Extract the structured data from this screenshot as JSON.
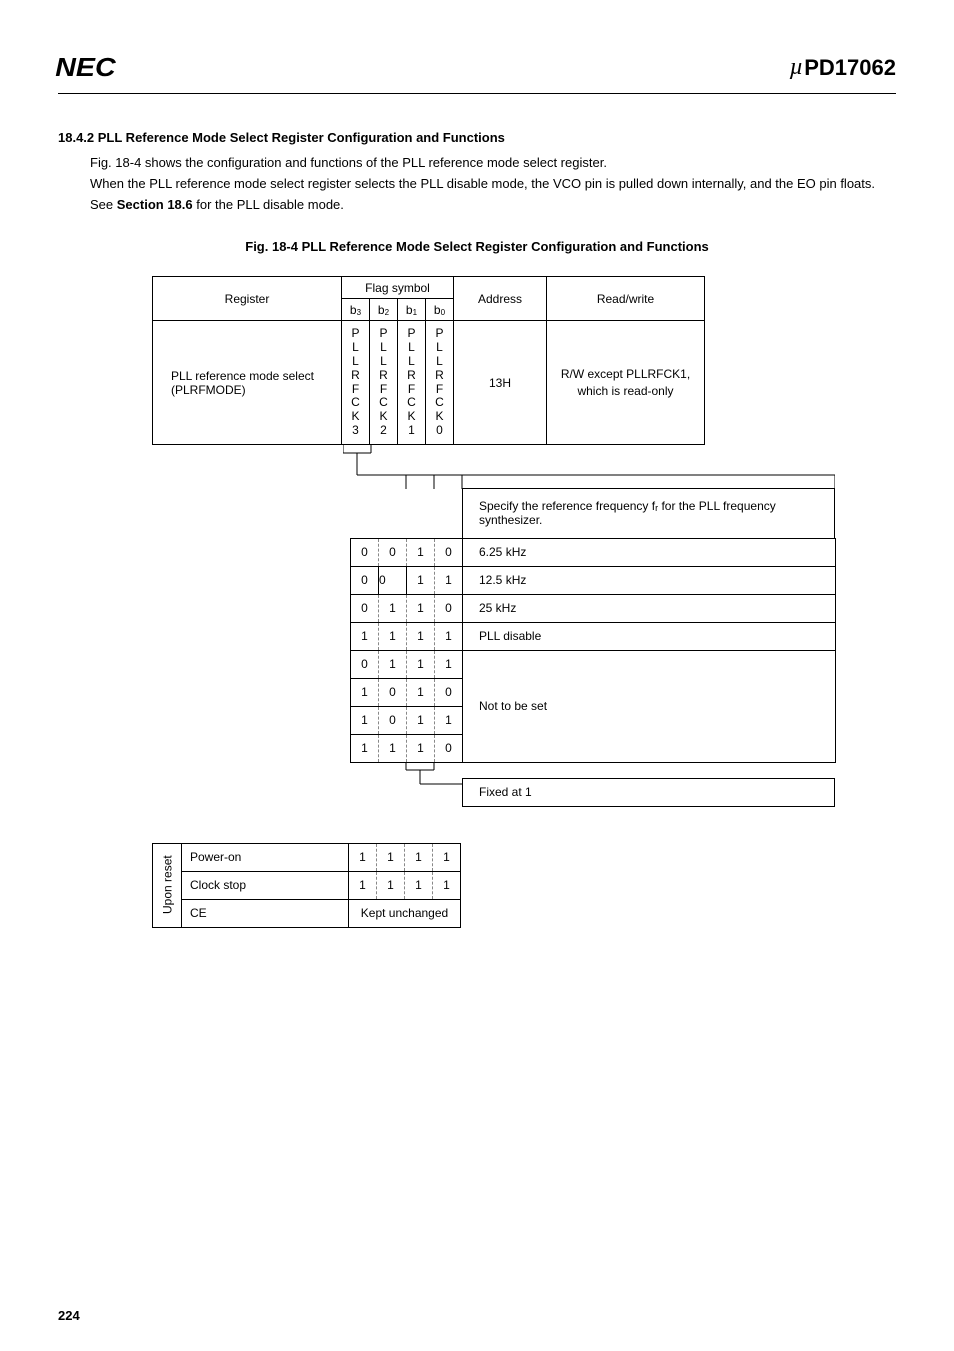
{
  "header": {
    "logo": "NEC",
    "part_prefix": "µ",
    "part_number": "PD17062"
  },
  "section": {
    "num_title": "18.4.2   PLL Reference Mode Select Register Configuration and Functions",
    "p1": "Fig. 18-4 shows the configuration and functions of the PLL reference mode select register.",
    "p2": "When the PLL reference mode select register selects the PLL disable mode, the VCO pin is pulled down internally, and the EO pin floats.",
    "p3_a": "See ",
    "p3_bold": "Section 18.6",
    "p3_b": " for the PLL disable mode."
  },
  "fig": {
    "title": "Fig. 18-4   PLL Reference Mode Select Register Configuration and Functions"
  },
  "t1": {
    "register_label": "Register",
    "flag_symbol_label": "Flag symbol",
    "address_label": "Address",
    "rw_label": "Read/write",
    "b_labels": [
      "b",
      "b",
      "b",
      "b"
    ],
    "b_subs": [
      "3",
      "2",
      "1",
      "0"
    ],
    "register_name": "PLL reference mode select (PLRFMODE)",
    "flag_cols": [
      [
        "P",
        "L",
        "L",
        "R",
        "F",
        "C",
        "K",
        "3"
      ],
      [
        "P",
        "L",
        "L",
        "R",
        "F",
        "C",
        "K",
        "2"
      ],
      [
        "P",
        "L",
        "L",
        "R",
        "F",
        "C",
        "K",
        "1"
      ],
      [
        "P",
        "L",
        "L",
        "R",
        "F",
        "C",
        "K",
        "0"
      ]
    ],
    "address": "13H",
    "rw_text": "R/W except PLLRFCK1, which is read-only"
  },
  "t2": {
    "header_a": "Specify the reference frequency f",
    "header_sub": "r",
    "header_b": " for the PLL frequency synthesizer.",
    "rows": [
      {
        "bits": [
          "0",
          "0",
          "1",
          "0"
        ],
        "desc": "6.25 kHz"
      },
      {
        "bits": [
          "0",
          "0",
          "1",
          "1"
        ],
        "desc": "12.5 kHz"
      },
      {
        "bits": [
          "0",
          "1",
          "1",
          "0"
        ],
        "desc": "25 kHz"
      },
      {
        "bits": [
          "1",
          "1",
          "1",
          "1"
        ],
        "desc": "PLL disable"
      }
    ],
    "not_set_label": "Not to be set",
    "not_set_rows": [
      [
        "0",
        "1",
        "1",
        "1"
      ],
      [
        "1",
        "0",
        "1",
        "0"
      ],
      [
        "1",
        "0",
        "1",
        "1"
      ],
      [
        "1",
        "1",
        "1",
        "0"
      ]
    ],
    "fixed_label": "Fixed at 1"
  },
  "t3": {
    "side_label": "Upon reset",
    "rows": [
      {
        "label": "Power-on",
        "bits": [
          "1",
          "1",
          "1",
          "1"
        ]
      },
      {
        "label": "Clock stop",
        "bits": [
          "1",
          "1",
          "1",
          "1"
        ]
      }
    ],
    "ce_label": "CE",
    "ce_value": "Kept unchanged"
  },
  "page_number": "224"
}
